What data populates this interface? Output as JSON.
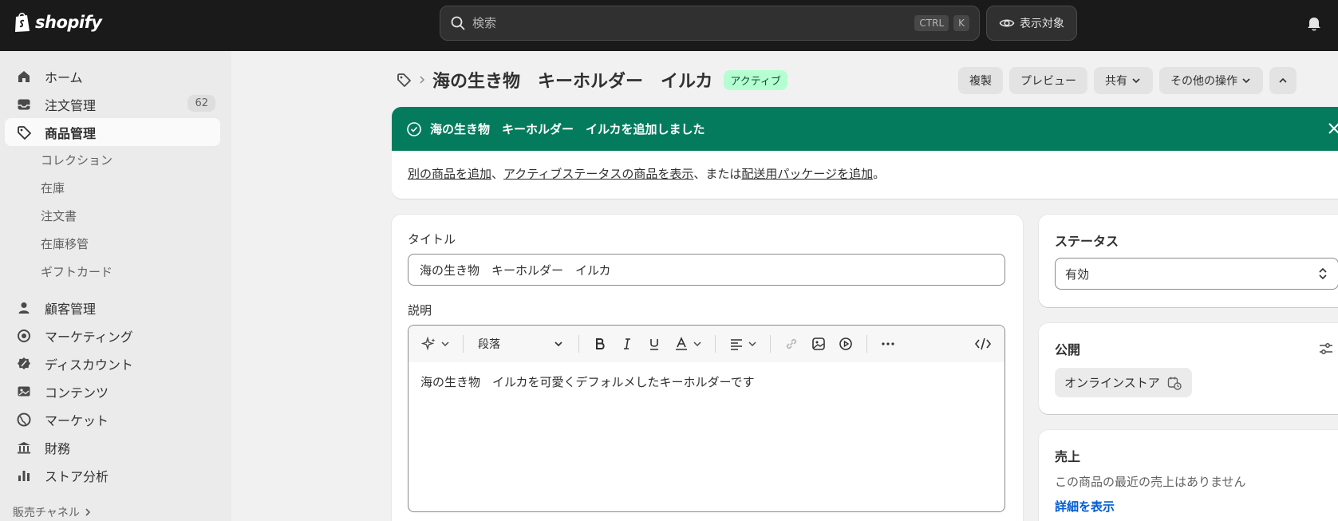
{
  "topbar": {
    "brand": "shopify",
    "search_placeholder": "検索",
    "kbd_ctrl": "CTRL",
    "kbd_k": "K",
    "view_label": "表示対象"
  },
  "sidebar": {
    "items": [
      {
        "label": "ホーム"
      },
      {
        "label": "注文管理",
        "count": "62"
      },
      {
        "label": "商品管理"
      },
      {
        "label": "コレクション"
      },
      {
        "label": "在庫"
      },
      {
        "label": "注文書"
      },
      {
        "label": "在庫移管"
      },
      {
        "label": "ギフトカード"
      },
      {
        "label": "顧客管理"
      },
      {
        "label": "マーケティング"
      },
      {
        "label": "ディスカウント"
      },
      {
        "label": "コンテンツ"
      },
      {
        "label": "マーケット"
      },
      {
        "label": "財務"
      },
      {
        "label": "ストア分析"
      }
    ],
    "channels_label": "販売チャネル"
  },
  "header": {
    "title": "海の生き物　キーホルダー　イルカ",
    "status_badge": "アクティブ",
    "actions": {
      "duplicate": "複製",
      "preview": "プレビュー",
      "share": "共有",
      "more": "その他の操作"
    }
  },
  "banner": {
    "title": "海の生き物　キーホルダー　イルカを追加しました",
    "link1": "別の商品を追加",
    "sep1": "、",
    "link2": "アクティブステータスの商品を表示",
    "sep2": "、または",
    "link3": "配送用パッケージを追加",
    "end": "。"
  },
  "product": {
    "title_label": "タイトル",
    "title_value": "海の生き物　キーホルダー　イルカ",
    "description_label": "説明",
    "paragraph_select": "段落",
    "description_value": "海の生き物　イルカを可愛くデフォルメしたキーホルダーです"
  },
  "status": {
    "title": "ステータス",
    "value": "有効"
  },
  "publishing": {
    "title": "公開",
    "channel": "オンラインストア"
  },
  "sales": {
    "title": "売上",
    "empty_text": "この商品の最近の売上はありません",
    "link": "詳細を表示"
  }
}
